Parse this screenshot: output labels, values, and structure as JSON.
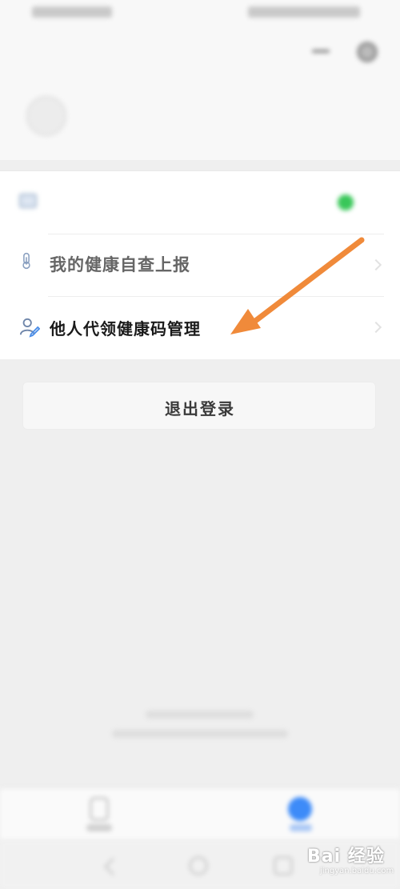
{
  "header": {
    "title": "",
    "user_name": "",
    "user_phone": ""
  },
  "menu": {
    "items": [
      {
        "label": "",
        "status": ""
      },
      {
        "label": "我的健康自查上报"
      },
      {
        "label": "他人代领健康码管理"
      }
    ]
  },
  "logout": {
    "label": "退出登录"
  },
  "watermark": {
    "text": "Bai 经验",
    "sub": "jingyan.baidu.com"
  },
  "colors": {
    "arrow": "#f08a3a",
    "status_dot": "#39c759",
    "tab_active": "#3d8bf8"
  },
  "icons": {
    "item_1": "card-icon",
    "item_2": "thermometer-icon",
    "item_3": "person-edit-icon"
  }
}
